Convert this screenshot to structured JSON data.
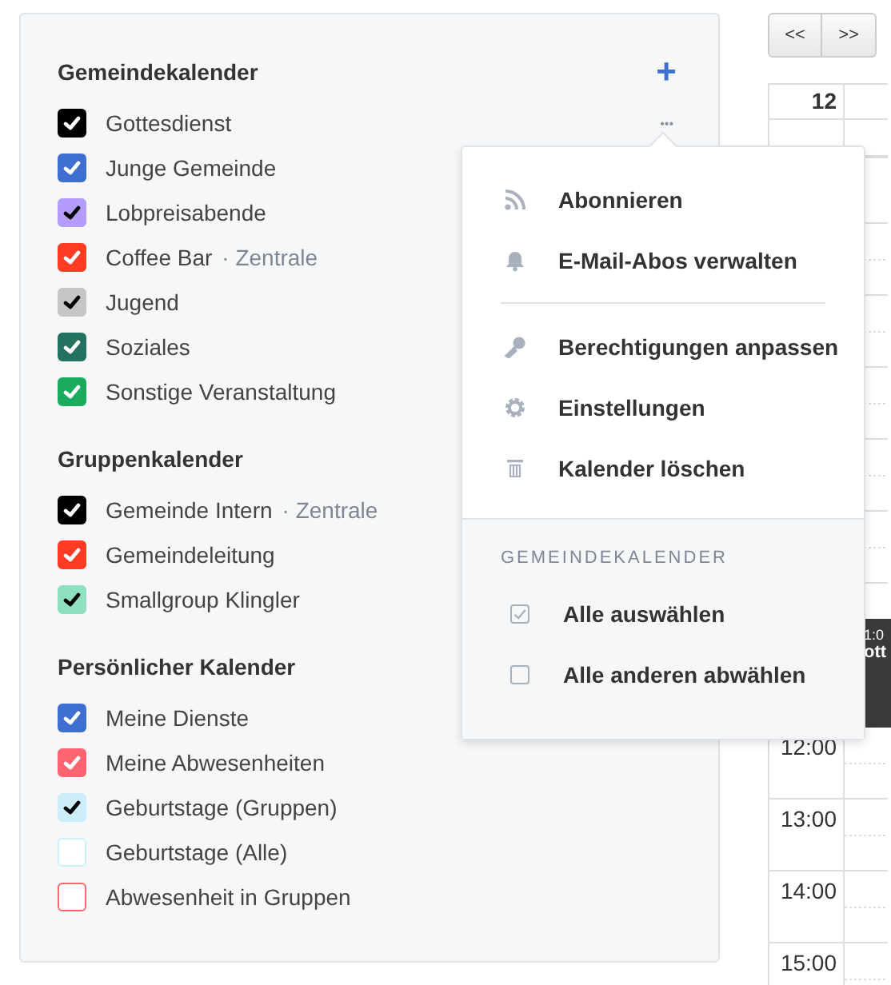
{
  "sidebar": {
    "add_label": "+",
    "more_label": "•••",
    "sections": [
      {
        "title": "Gemeindekalender",
        "items": [
          {
            "label": "Gottesdienst",
            "color": "#000000",
            "checked": true
          },
          {
            "label": "Junge Gemeinde",
            "color": "#3e6fd1",
            "checked": true
          },
          {
            "label": "Lobpreisabende",
            "color": "#b39cfb",
            "checked": true
          },
          {
            "label": "Coffee Bar",
            "suffix": "· Zentrale",
            "color": "#ff3b24",
            "checked": true
          },
          {
            "label": "Jugend",
            "color": "#c6c6c6",
            "checked": true
          },
          {
            "label": "Soziales",
            "color": "#25715f",
            "checked": true
          },
          {
            "label": "Sonstige Veranstaltung",
            "color": "#1aab5f",
            "checked": true
          }
        ]
      },
      {
        "title": "Gruppenkalender",
        "items": [
          {
            "label": "Gemeinde Intern",
            "suffix": "· Zentrale",
            "color": "#000000",
            "checked": true
          },
          {
            "label": "Gemeindeleitung",
            "color": "#ff3b24",
            "checked": true
          },
          {
            "label": "Smallgroup Klingler",
            "color": "#8fe0bf",
            "checked": true
          }
        ]
      },
      {
        "title": "Persönlicher Kalender",
        "items": [
          {
            "label": "Meine Dienste",
            "color": "#3e6fd1",
            "checked": true
          },
          {
            "label": "Meine Abwesenheiten",
            "color": "#ff6570",
            "checked": true
          },
          {
            "label": "Geburtstage (Gruppen)",
            "color": "#cdeef9",
            "checked": true
          },
          {
            "label": "Geburtstage (Alle)",
            "color": "#cdeef9",
            "checked": false
          },
          {
            "label": "Abwesenheit in Gruppen",
            "color": "#ff6570",
            "checked": false
          }
        ]
      }
    ]
  },
  "menu": {
    "groups": [
      [
        {
          "label": "Abonnieren",
          "kind": "rss"
        },
        {
          "label": "E-Mail-Abos verwalten",
          "kind": "bell"
        }
      ],
      [
        {
          "label": "Berechtigungen anpassen",
          "kind": "key"
        },
        {
          "label": "Einstellungen",
          "kind": "gear"
        },
        {
          "label": "Kalender löschen",
          "kind": "trash"
        }
      ]
    ],
    "section_title": "GEMEINDEKALENDER",
    "select_items": [
      {
        "label": "Alle auswählen",
        "checked": true
      },
      {
        "label": "Alle anderen abwählen",
        "checked": false
      }
    ]
  },
  "calendar": {
    "prev": "<<",
    "next": ">>",
    "day": "12",
    "hours": [
      "12:00",
      "13:00",
      "14:00",
      "15:00"
    ],
    "event": {
      "time": "1:0",
      "title": "ott"
    }
  }
}
